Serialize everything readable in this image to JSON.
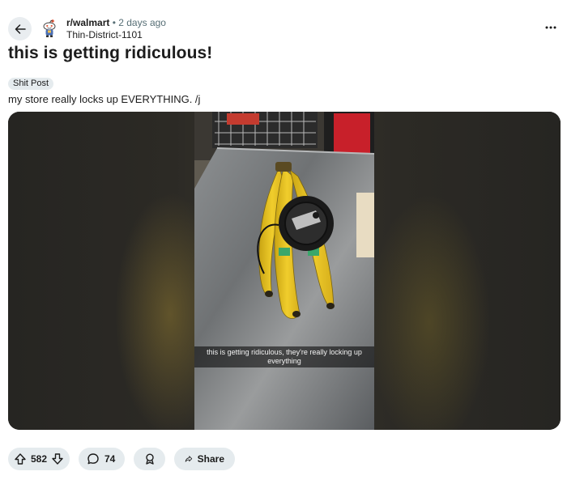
{
  "post": {
    "subreddit": "r/walmart",
    "separator": "•",
    "time_ago": "2 days ago",
    "author": "Thin-District-1101",
    "title": "this is getting ridiculous!",
    "flair": "Shit Post",
    "body": "my store really locks up EVERYTHING. /j",
    "image_caption_line1": "this is getting ridiculous, they're really locking up",
    "image_caption_line2": "everything"
  },
  "actions": {
    "score": "582",
    "comments": "74",
    "share_label": "Share"
  },
  "icons": {
    "back": "arrow-left-icon",
    "more": "ellipsis-icon",
    "upvote": "arrow-up-icon",
    "downvote": "arrow-down-icon",
    "comment": "speech-bubble-icon",
    "award": "award-icon",
    "share": "share-arrow-icon"
  },
  "colors": {
    "pill_bg": "#e5ebee",
    "meta_gray": "#576f76",
    "snoo_blue": "#4a6fb5"
  }
}
